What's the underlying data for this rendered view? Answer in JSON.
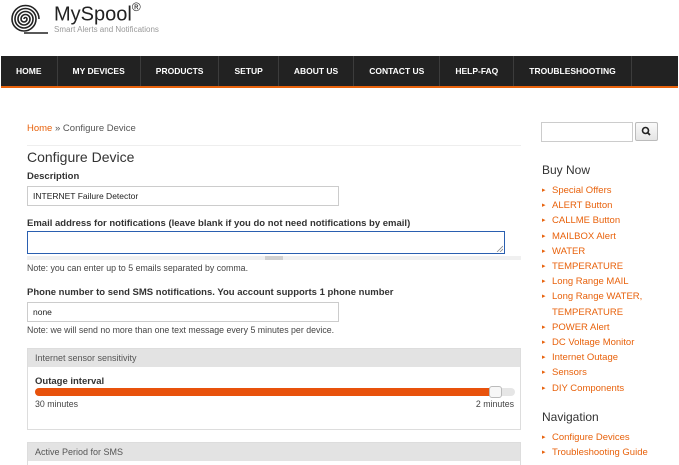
{
  "header": {
    "brand": "MySpool",
    "brand_mark": "®",
    "tagline": "Smart Alerts and Notifications"
  },
  "nav": {
    "items": [
      "HOME",
      "MY DEVICES",
      "PRODUCTS",
      "SETUP",
      "ABOUT US",
      "CONTACT US",
      "HELP-FAQ",
      "TROUBLESHOOTING"
    ]
  },
  "breadcrumb": {
    "home": "Home",
    "separator": "»",
    "current": "Configure Device"
  },
  "page_title": "Configure Device",
  "form": {
    "description_label": "Description",
    "description_value": "INTERNET Failure Detector",
    "email_label": "Email address for notifications (leave blank if you do not need notifications by email)",
    "email_value": "",
    "email_note": "Note: you can enter up to 5 emails separated by comma.",
    "sms_label": "Phone number to send SMS notifications. You account supports 1 phone number",
    "sms_value": "none",
    "sms_note": "Note: we will send no more than one text message every 5 minutes per device."
  },
  "sensitivity_panel": {
    "title": "Internet sensor sensitivity",
    "slider_label": "Outage interval",
    "min_label": "30 minutes",
    "max_label": "2 minutes",
    "value_fraction": 0.96
  },
  "sms_panel": {
    "title": "Active Period for SMS"
  },
  "sidebar": {
    "search_icon": "magnifier-icon",
    "buy_now_heading": "Buy Now",
    "buy_now_items": [
      "Special Offers",
      "ALERT Button",
      "CALLME Button",
      "MAILBOX Alert",
      "WATER",
      "TEMPERATURE",
      "Long Range MAIL",
      "Long Range WATER,",
      "TEMPERATURE",
      "POWER Alert",
      "DC Voltage Monitor",
      "Internet Outage",
      "Sensors",
      "DIY Components"
    ],
    "navigation_heading": "Navigation",
    "navigation_items": [
      "Configure Devices",
      "Troubleshooting Guide"
    ]
  },
  "colors": {
    "accent": "#e8620c",
    "nav_bg": "#222222",
    "focus_border": "#2a5fb0"
  }
}
